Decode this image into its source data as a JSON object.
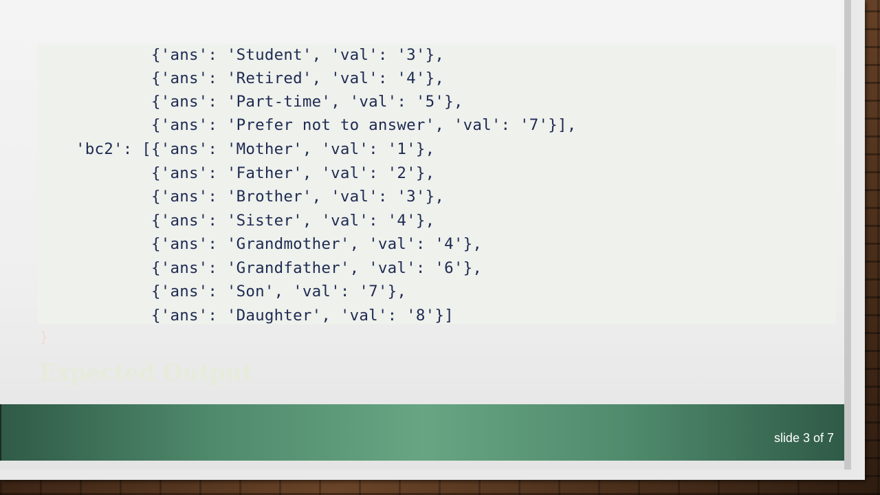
{
  "code": {
    "lines": [
      "            {'ans': 'Student', 'val': '3'},",
      "            {'ans': 'Retired', 'val': '4'},",
      "            {'ans': 'Part-time', 'val': '5'},",
      "            {'ans': 'Prefer not to answer', 'val': '7'}],",
      "    'bc2': [{'ans': 'Mother', 'val': '1'},",
      "            {'ans': 'Father', 'val': '2'},",
      "            {'ans': 'Brother', 'val': '3'},",
      "            {'ans': 'Sister', 'val': '4'},",
      "            {'ans': 'Grandmother', 'val': '4'},",
      "            {'ans': 'Grandfather', 'val': '6'},",
      "            {'ans': 'Son', 'val': '7'},",
      "            {'ans': 'Daughter', 'val': '8'}]"
    ]
  },
  "ghost": {
    "brace": "}",
    "heading": "Expected Output"
  },
  "footer": {
    "counter": "slide 3 of 7"
  },
  "colors": {
    "code_text": "#1f2a52",
    "code_background": "#eef1ec",
    "footer_green": "#67a583"
  }
}
